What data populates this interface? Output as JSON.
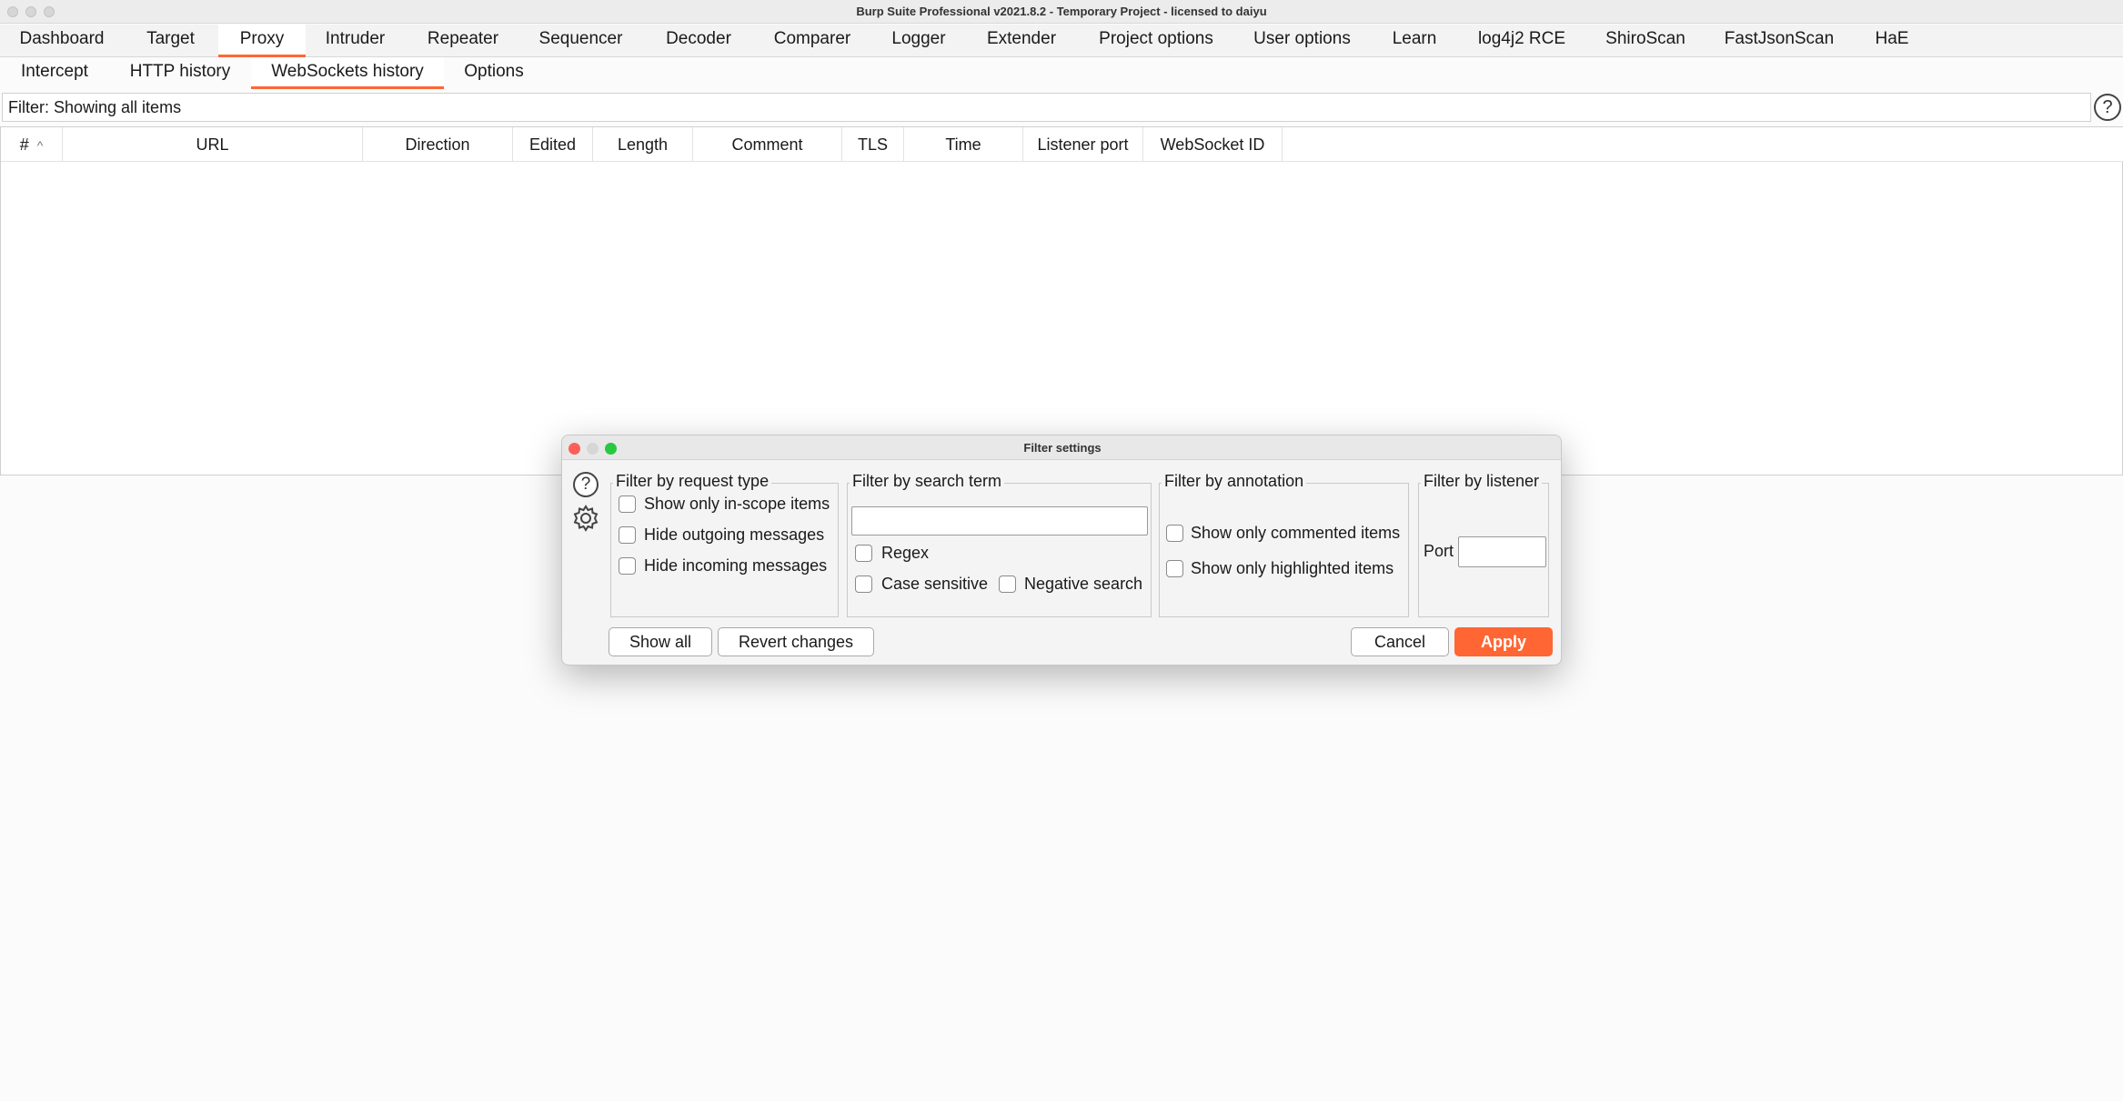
{
  "window": {
    "title": "Burp Suite Professional v2021.8.2 - Temporary Project - licensed to daiyu"
  },
  "main_tabs": [
    {
      "label": "Dashboard",
      "active": false
    },
    {
      "label": "Target",
      "active": false
    },
    {
      "label": "Proxy",
      "active": true
    },
    {
      "label": "Intruder",
      "active": false
    },
    {
      "label": "Repeater",
      "active": false
    },
    {
      "label": "Sequencer",
      "active": false
    },
    {
      "label": "Decoder",
      "active": false
    },
    {
      "label": "Comparer",
      "active": false
    },
    {
      "label": "Logger",
      "active": false
    },
    {
      "label": "Extender",
      "active": false
    },
    {
      "label": "Project options",
      "active": false
    },
    {
      "label": "User options",
      "active": false
    },
    {
      "label": "Learn",
      "active": false
    },
    {
      "label": "log4j2 RCE",
      "active": false
    },
    {
      "label": "ShiroScan",
      "active": false
    },
    {
      "label": "FastJsonScan",
      "active": false
    },
    {
      "label": "HaE",
      "active": false
    }
  ],
  "sub_tabs": [
    {
      "label": "Intercept",
      "active": false
    },
    {
      "label": "HTTP history",
      "active": false
    },
    {
      "label": "WebSockets history",
      "active": true
    },
    {
      "label": "Options",
      "active": false
    }
  ],
  "filter_bar": {
    "text": "Filter: Showing all items",
    "help_glyph": "?"
  },
  "table": {
    "columns": [
      "#",
      "URL",
      "Direction",
      "Edited",
      "Length",
      "Comment",
      "TLS",
      "Time",
      "Listener port",
      "WebSocket ID"
    ],
    "sort_indicator": "^",
    "rows": []
  },
  "dialog": {
    "title": "Filter settings",
    "help_glyph": "?",
    "request_type": {
      "legend": "Filter by request type",
      "options": [
        {
          "label": "Show only in-scope items",
          "checked": false
        },
        {
          "label": "Hide outgoing messages",
          "checked": false
        },
        {
          "label": "Hide incoming messages",
          "checked": false
        }
      ]
    },
    "search_term": {
      "legend": "Filter by search term",
      "value": "",
      "regex_label": "Regex",
      "case_label": "Case sensitive",
      "negative_label": "Negative search"
    },
    "annotation": {
      "legend": "Filter by annotation",
      "commented_label": "Show only commented items",
      "highlighted_label": "Show only highlighted items"
    },
    "listener": {
      "legend": "Filter by listener",
      "port_label": "Port",
      "port_value": ""
    },
    "buttons": {
      "show_all": "Show all",
      "revert": "Revert changes",
      "cancel": "Cancel",
      "apply": "Apply"
    }
  },
  "colors": {
    "accent": "#ff6633",
    "close": "#ff5f57",
    "minimize": "#d6d6d6",
    "zoom": "#28c840"
  },
  "icons": {
    "help": "question-circle-icon",
    "settings": "gear-icon",
    "sort": "sort-ascending-icon"
  }
}
